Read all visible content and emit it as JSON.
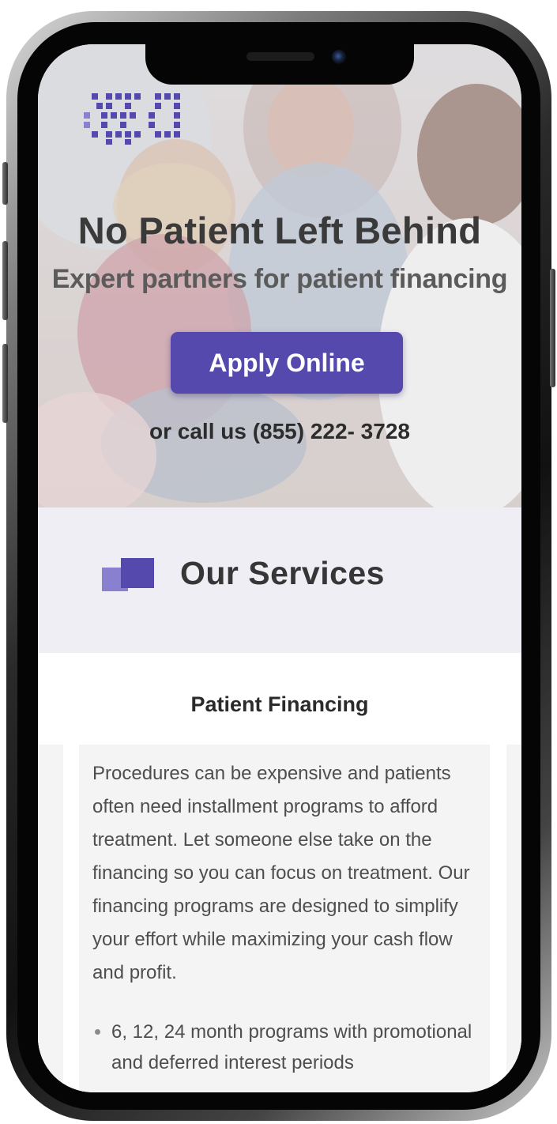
{
  "hero": {
    "title": "No Patient Left Behind",
    "subtitle": "Expert partners for patient financing",
    "apply_button": "Apply Online",
    "call_text": "or call us (855) 222- 3728"
  },
  "services": {
    "heading": "Our Services"
  },
  "card": {
    "title": "Patient Financing",
    "description": "Procedures can be expensive and patients often need installment programs to afford treatment. Let someone else  take on the financing  so you can focus on treatment. Our financing programs are designed to simplify your effort while maximizing your cash flow and profit.",
    "bullets": [
      "6, 12, 24 month programs with promotional  and deferred interest periods"
    ]
  },
  "colors": {
    "brand_purple": "#5549ad",
    "brand_purple_light": "#8a80d0",
    "services_band": "#efeef4"
  }
}
